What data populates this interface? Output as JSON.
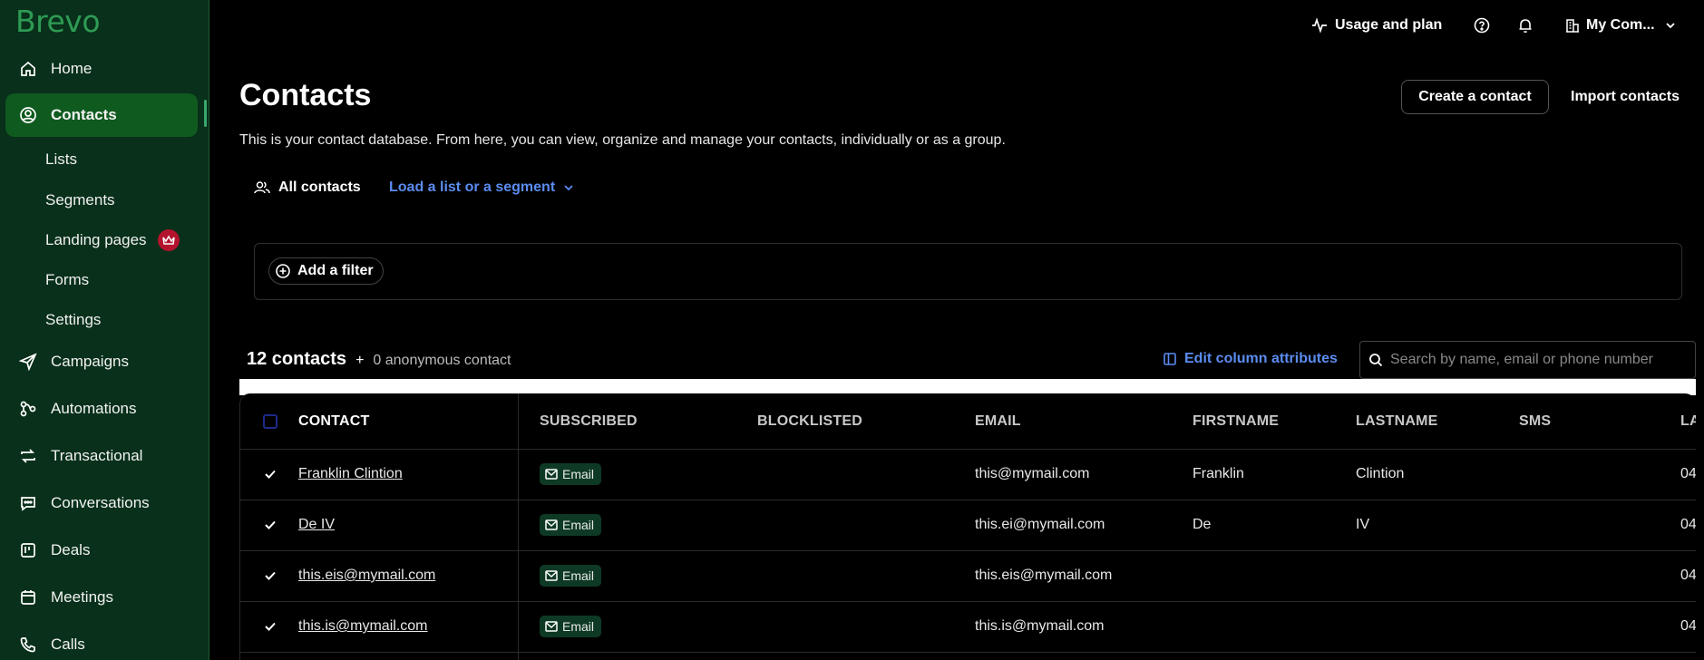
{
  "sidebar": {
    "logo": "Brevo",
    "nav": {
      "home": "Home",
      "contacts": "Contacts",
      "campaigns": "Campaigns",
      "automations": "Automations",
      "transactional": "Transactional",
      "conversations": "Conversations",
      "deals": "Deals",
      "meetings": "Meetings",
      "calls": "Calls"
    },
    "contacts_sub": {
      "lists": "Lists",
      "segments": "Segments",
      "landing_pages": "Landing pages",
      "forms": "Forms",
      "settings": "Settings"
    }
  },
  "topbar": {
    "usage": "Usage and plan",
    "company": "My Com..."
  },
  "page": {
    "title": "Contacts",
    "description": "This is your contact database. From here, you can view, organize and manage your contacts, individually or as a group.",
    "create_button": "Create a contact",
    "import_button": "Import contacts",
    "tab_all": "All contacts",
    "tab_load": "Load a list or a segment",
    "add_filter": "Add a filter",
    "count_label": "12 contacts",
    "plus": "+",
    "anonymous": "0 anonymous contact",
    "edit_columns": "Edit column attributes",
    "search_placeholder": "Search by name, email or phone number"
  },
  "table": {
    "headers": {
      "contact": "CONTACT",
      "subscribed": "SUBSCRIBED",
      "blocklisted": "BLOCKLISTED",
      "email": "EMAIL",
      "firstname": "FIRSTNAME",
      "lastname": "LASTNAME",
      "sms": "SMS",
      "last": "LA"
    },
    "rows": [
      {
        "contact": "Franklin Clintion",
        "subscribed": "Email",
        "email": "this@mymail.com",
        "firstname": "Franklin",
        "lastname": "Clintion",
        "last": "04"
      },
      {
        "contact": "De IV",
        "subscribed": "Email",
        "email": "this.ei@mymail.com",
        "firstname": "De",
        "lastname": "IV",
        "last": "04"
      },
      {
        "contact": "this.eis@mymail.com",
        "subscribed": "Email",
        "email": "this.eis@mymail.com",
        "firstname": "",
        "lastname": "",
        "last": "04"
      },
      {
        "contact": "this.is@mymail.com",
        "subscribed": "Email",
        "email": "this.is@mymail.com",
        "firstname": "",
        "lastname": "",
        "last": "04"
      }
    ]
  },
  "colors": {
    "sidebar_bg": "#08301a",
    "active_item": "#0f5a1f",
    "accent_blue": "#5b8cf0",
    "badge_bg": "#0e3a25",
    "crown": "#b3132d"
  }
}
